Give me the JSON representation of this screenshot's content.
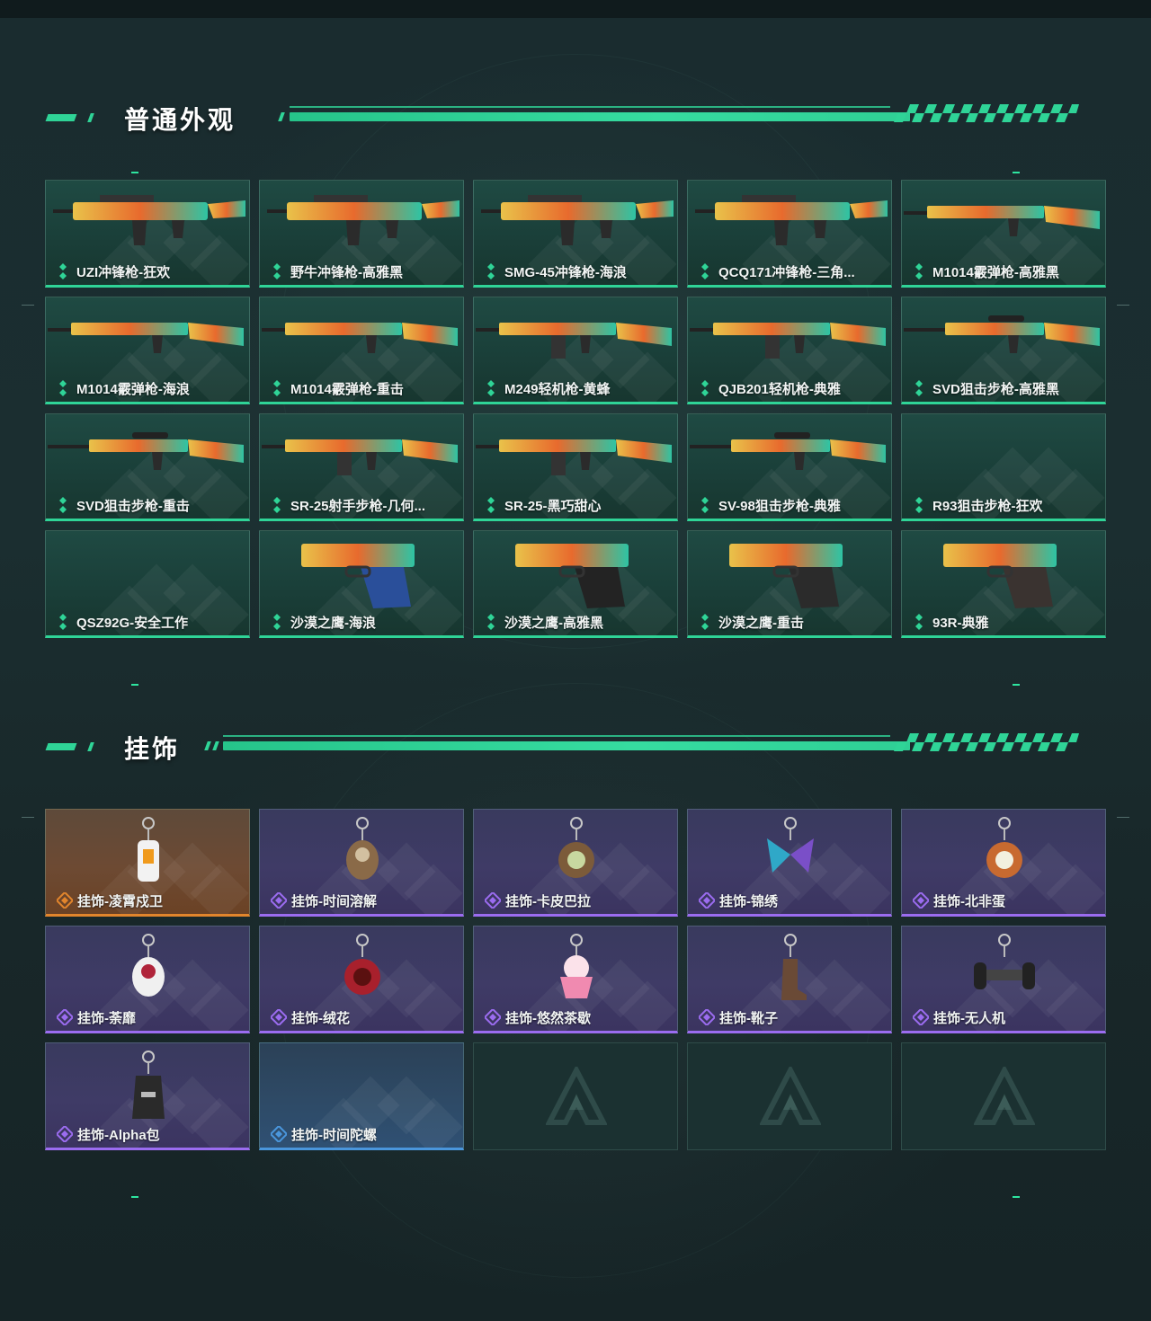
{
  "sections": {
    "skins": {
      "title": "普通外观"
    },
    "charms": {
      "title": "挂饰"
    }
  },
  "colors": {
    "accent_green": "#2fd497",
    "charm_orange": "#e2852c",
    "charm_purple": "#9b6cf0",
    "charm_blue": "#4a96dc"
  },
  "skins": [
    {
      "label": "UZI冲锋枪-狂欢",
      "art": "smg-uzi-orange-teal"
    },
    {
      "label": "野牛冲锋枪-高雅黑",
      "art": "smg-bizon-black"
    },
    {
      "label": "SMG-45冲锋枪-海浪",
      "art": "smg-blue-wave"
    },
    {
      "label": "QCQ171冲锋枪-三角...",
      "art": "smg-red-pattern"
    },
    {
      "label": "M1014霰弹枪-高雅黑",
      "art": "shotgun-black"
    },
    {
      "label": "M1014霰弹枪-海浪",
      "art": "shotgun-blue-wave"
    },
    {
      "label": "M1014霰弹枪-重击",
      "art": "shotgun-white-purple"
    },
    {
      "label": "M249轻机枪-黄蜂",
      "art": "lmg-yellow-black"
    },
    {
      "label": "QJB201轻机枪-典雅",
      "art": "lmg-white"
    },
    {
      "label": "SVD狙击步枪-高雅黑",
      "art": "sniper-black"
    },
    {
      "label": "SVD狙击步枪-重击",
      "art": "sniper-white-purple"
    },
    {
      "label": "SR-25射手步枪-几何...",
      "art": "rifle-camo"
    },
    {
      "label": "SR-25-黑巧甜心",
      "art": "rifle-pink"
    },
    {
      "label": "SV-98狙击步枪-典雅",
      "art": "sniper-white-brown"
    },
    {
      "label": "R93狙击步枪-狂欢",
      "art": "none"
    },
    {
      "label": "QSZ92G-安全工作",
      "art": "none"
    },
    {
      "label": "沙漠之鹰-海浪",
      "art": "pistol-blue-wave"
    },
    {
      "label": "沙漠之鹰-高雅黑",
      "art": "pistol-black"
    },
    {
      "label": "沙漠之鹰-重击",
      "art": "pistol-white-purple"
    },
    {
      "label": "93R-典雅",
      "art": "pistol-white-tan"
    }
  ],
  "charms": [
    {
      "label": "挂饰-凌霄戍卫",
      "tier": "orange",
      "art": "charm-guard"
    },
    {
      "label": "挂饰-时间溶解",
      "tier": "purple",
      "art": "charm-melt"
    },
    {
      "label": "挂饰-卡皮巴拉",
      "tier": "purple",
      "art": "charm-capybara"
    },
    {
      "label": "挂饰-锦绣",
      "tier": "purple",
      "art": "charm-butterfly"
    },
    {
      "label": "挂饰-北非蛋",
      "tier": "purple",
      "art": "charm-shakshuka"
    },
    {
      "label": "挂饰-荼靡",
      "tier": "purple",
      "art": "charm-white-creature"
    },
    {
      "label": "挂饰-绒花",
      "tier": "purple",
      "art": "charm-rose"
    },
    {
      "label": "挂饰-悠然茶歇",
      "tier": "purple",
      "art": "charm-cupcake"
    },
    {
      "label": "挂饰-靴子",
      "tier": "purple",
      "art": "charm-boot"
    },
    {
      "label": "挂饰-无人机",
      "tier": "purple",
      "art": "charm-drone"
    },
    {
      "label": "挂饰-Alpha包",
      "tier": "purple",
      "art": "charm-bag"
    },
    {
      "label": "挂饰-时间陀螺",
      "tier": "blue",
      "art": "none"
    },
    {
      "label": "",
      "tier": "empty",
      "art": "logo"
    },
    {
      "label": "",
      "tier": "empty",
      "art": "logo"
    },
    {
      "label": "",
      "tier": "empty",
      "art": "logo"
    }
  ]
}
